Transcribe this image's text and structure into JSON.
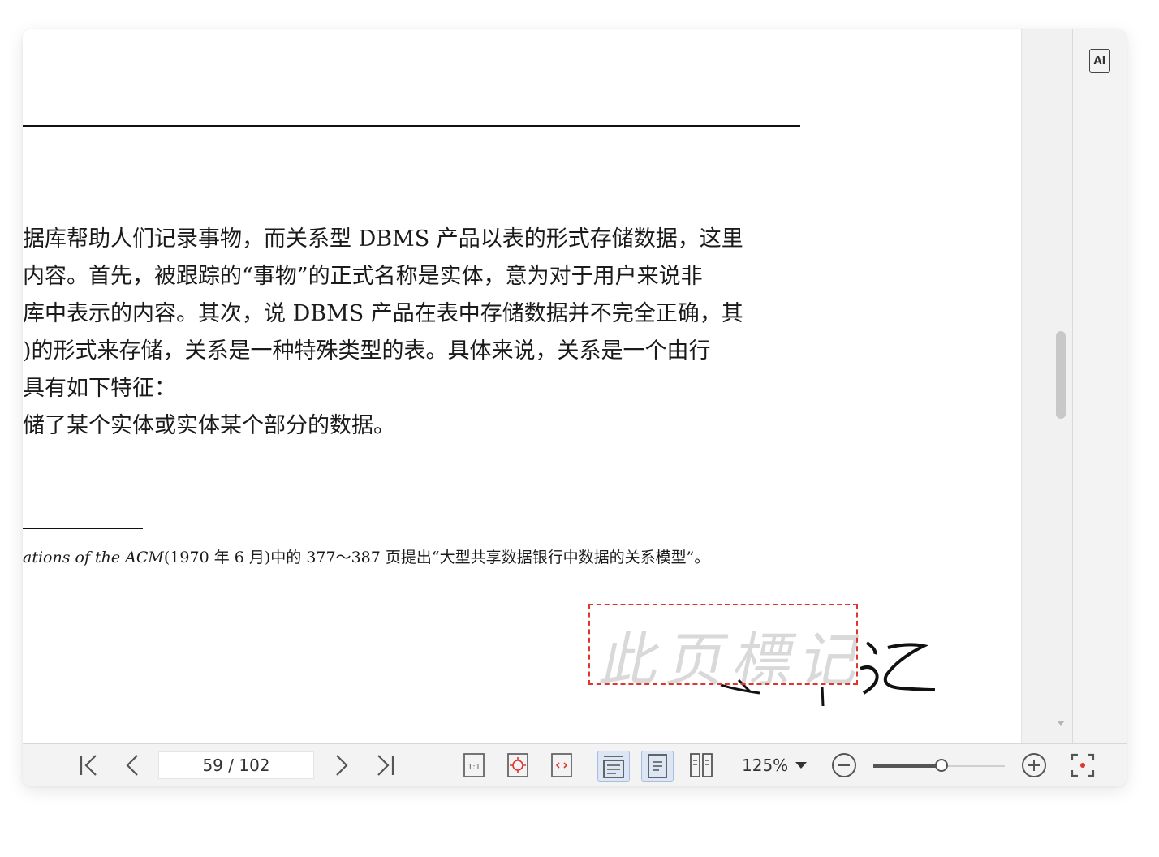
{
  "document": {
    "lines": [
      "据库帮助人们记录事物，而关系型 DBMS 产品以表的形式存储数据，这里",
      "内容。首先，被跟踪的“事物”的正式名称是实体，意为对于用户来说非",
      "库中表示的内容。其次，说 DBMS 产品在表中存储数据并不完全正确，其",
      ")的形式来存储，关系是一种特殊类型的表。具体来说，关系是一个由行",
      "具有如下特征：",
      "储了某个实体或实体某个部分的数据。"
    ],
    "footnote_italic": "ations of the ACM",
    "footnote_rest": "(1970 年 6 月)中的 377～387 页提出“大型共享数据银行中数据的关系模型”。",
    "signature_watermark": "此页標记"
  },
  "right_panel": {
    "ai_label": "AI"
  },
  "toolbar": {
    "page_indicator": "59 / 102",
    "zoom_label": "125%",
    "zoom_level_fraction": 0.52,
    "active_views": [
      "continuous-scroll",
      "single-page"
    ]
  },
  "colors": {
    "signature_box": "#e0342f",
    "active_button_bg": "#dde6f5",
    "toolbar_bg": "#f3f3f3"
  },
  "icons": [
    "first-page-icon",
    "prev-page-icon",
    "next-page-icon",
    "last-page-icon",
    "actual-size-icon",
    "fit-page-icon",
    "fit-width-icon",
    "continuous-scroll-icon",
    "single-page-icon",
    "two-page-icon",
    "zoom-out-icon",
    "zoom-in-icon",
    "fullscreen-icon",
    "ai-icon"
  ]
}
